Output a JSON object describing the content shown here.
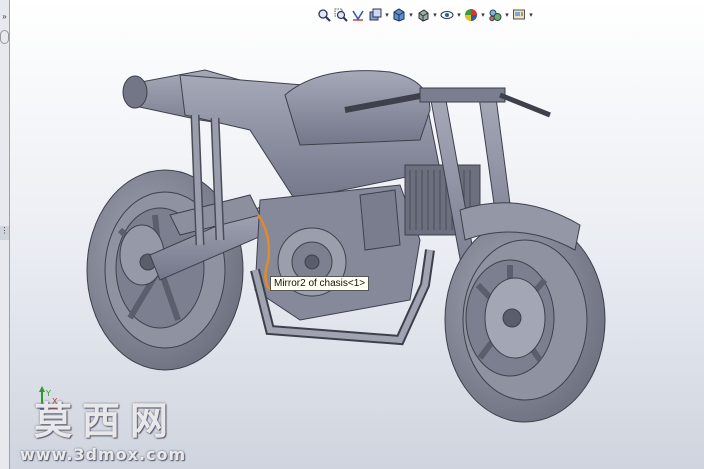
{
  "left_panel": {
    "collapse_glyph": "»",
    "handle_glyph": "⋮"
  },
  "toolbar": {
    "buttons": [
      {
        "id": "zoom-to-fit",
        "icon": "zoom-fit-icon"
      },
      {
        "id": "zoom-area",
        "icon": "zoom-area-icon"
      },
      {
        "id": "previous-view",
        "icon": "previous-view-icon"
      },
      {
        "id": "section-view",
        "icon": "section-view-icon"
      },
      {
        "id": "view-orientation",
        "icon": "view-orientation-icon"
      },
      {
        "id": "display-style",
        "icon": "display-style-icon"
      },
      {
        "id": "hide-show",
        "icon": "hide-show-icon"
      },
      {
        "id": "edit-appearance",
        "icon": "appearance-icon"
      },
      {
        "id": "scenes",
        "icon": "scene-icon"
      },
      {
        "id": "view-settings",
        "icon": "view-settings-icon"
      }
    ],
    "caret_glyph": "▾"
  },
  "viewport": {
    "tooltip": "Mirror2 of chasis<1>",
    "model_color": "#8c8f9e",
    "highlight_color": "#e08a2a",
    "glass_color": "#8fb6d6"
  },
  "triad": {
    "x": "X",
    "y": "Y"
  },
  "watermark": {
    "chinese": "莫西网",
    "url": "www.3dmox.com"
  }
}
